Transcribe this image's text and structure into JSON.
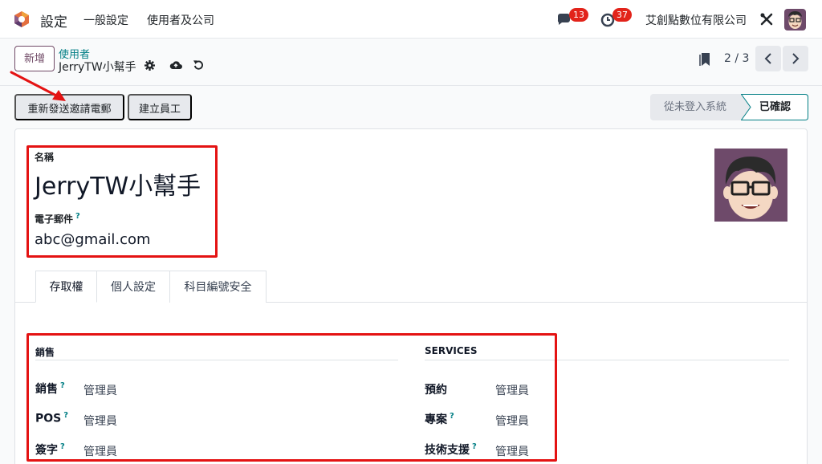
{
  "navbar": {
    "brand": "設定",
    "menu": [
      "一般設定",
      "使用者及公司"
    ],
    "messages_count": "13",
    "activities_count": "37",
    "company": "艾創點數位有限公司"
  },
  "control_panel": {
    "new_label": "新增",
    "breadcrumb": "使用者",
    "record_name": "JerryTW小幫手",
    "pager": "2 / 3"
  },
  "actions": {
    "resend_invite": "重新發送邀請電郵",
    "create_employee": "建立員工"
  },
  "status": {
    "stages": [
      "從未登入系統",
      "已確認"
    ],
    "active": "已確認"
  },
  "form": {
    "name_label": "名稱",
    "name_value": "JerryTW小幫手",
    "email_label": "電子郵件",
    "help_mark": "?",
    "email_value": "abc@gmail.com"
  },
  "tabs": [
    "存取權",
    "個人設定",
    "科目編號安全"
  ],
  "groups": {
    "sales": {
      "title": "銷售",
      "fields": [
        {
          "label": "銷售",
          "value": "管理員"
        },
        {
          "label": "POS",
          "value": "管理員"
        },
        {
          "label": "簽字",
          "value": "管理員"
        }
      ]
    },
    "services": {
      "title": "SERVICES",
      "fields": [
        {
          "label": "預約",
          "value": "管理員"
        },
        {
          "label": "專案",
          "value": "管理員"
        },
        {
          "label": "技術支援",
          "value": "管理員"
        }
      ]
    }
  },
  "colors": {
    "primary": "#714b67",
    "link": "#017e84",
    "badge": "#e2231a",
    "annotation": "#e41313"
  }
}
